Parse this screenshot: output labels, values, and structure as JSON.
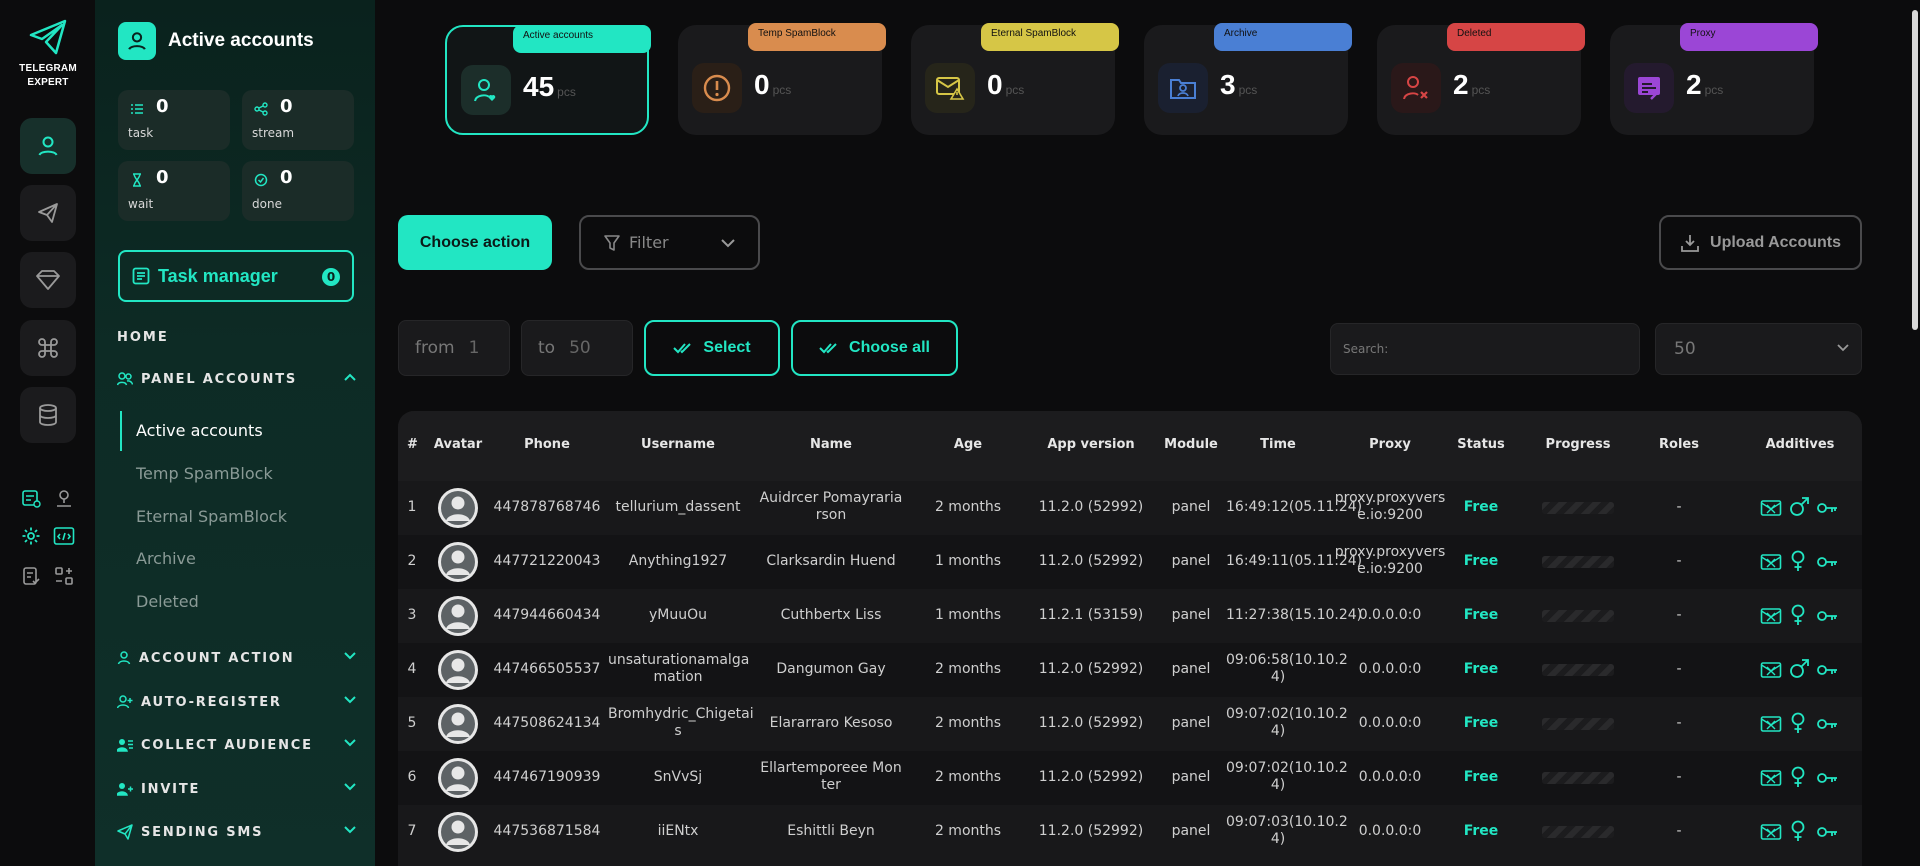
{
  "app": {
    "logo_line1": "TELEGRAM",
    "logo_line2": "EXPERT"
  },
  "sidebar": {
    "title": "Active accounts",
    "stats": [
      {
        "value": "0",
        "label": "task"
      },
      {
        "value": "0",
        "label": "stream"
      },
      {
        "value": "0",
        "label": "wait"
      },
      {
        "value": "0",
        "label": "done"
      }
    ],
    "task_manager": {
      "label": "Task manager",
      "count": "0"
    },
    "home_label": "HOME",
    "panel_accounts": "PANEL ACCOUNTS",
    "sub_items": [
      "Active accounts",
      "Temp SpamBlock",
      "Eternal SpamBlock",
      "Archive",
      "Deleted"
    ],
    "sections": [
      "ACCOUNT ACTION",
      "AUTO-REGISTER",
      "COLLECT AUDIENCE",
      "INVITE",
      "SENDING SMS"
    ]
  },
  "cards": [
    {
      "tag": "Active accounts",
      "value": "45",
      "unit": "pcs",
      "color": "#22e6c3",
      "icon": "user-heart-icon"
    },
    {
      "tag": "Temp SpamBlock",
      "value": "0",
      "unit": "pcs",
      "color": "#d98c4e",
      "icon": "warning-circle-icon"
    },
    {
      "tag": "Eternal SpamBlock",
      "value": "0",
      "unit": "pcs",
      "color": "#d6c646",
      "icon": "mail-warning-icon"
    },
    {
      "tag": "Archive",
      "value": "3",
      "unit": "pcs",
      "color": "#4a7fd4",
      "icon": "archive-user-icon"
    },
    {
      "tag": "Deleted",
      "value": "2",
      "unit": "pcs",
      "color": "#d64545",
      "icon": "user-x-icon"
    },
    {
      "tag": "Proxy",
      "value": "2",
      "unit": "pcs",
      "color": "#9b46d6",
      "icon": "proxy-icon"
    }
  ],
  "toolbar": {
    "choose_action": "Choose action",
    "filter": "Filter",
    "upload": "Upload Accounts",
    "from_label": "from",
    "from_value": "1",
    "to_label": "to",
    "to_value": "50",
    "select": "Select",
    "choose_all": "Choose all",
    "search_placeholder": "Search:",
    "per_page": "50"
  },
  "table": {
    "headers": [
      "#",
      "Avatar",
      "Phone",
      "Username",
      "Name",
      "Age",
      "App version",
      "Module",
      "Time",
      "Proxy",
      "Status",
      "Progress",
      "Roles",
      "Additives"
    ],
    "rows": [
      {
        "num": "1",
        "phone": "447878768746",
        "username": [
          "tellurium_dassent"
        ],
        "name": [
          "Auidrcer Pomayraria",
          "rson"
        ],
        "age": "2 months",
        "app": "11.2.0 (52992)",
        "module": "panel",
        "time": [
          "16:49:12(05.11.24)"
        ],
        "proxy": [
          "proxy.proxyvers",
          "e.io:9200"
        ],
        "status": "Free",
        "roles": "-",
        "gender": "male"
      },
      {
        "num": "2",
        "phone": "447721220043",
        "username": [
          "Anything1927"
        ],
        "name": [
          "Clarksardin Huend"
        ],
        "age": "1 months",
        "app": "11.2.0 (52992)",
        "module": "panel",
        "time": [
          "16:49:11(05.11.24)"
        ],
        "proxy": [
          "proxy.proxyvers",
          "e.io:9200"
        ],
        "status": "Free",
        "roles": "-",
        "gender": "female"
      },
      {
        "num": "3",
        "phone": "447944660434",
        "username": [
          "yMuuOu"
        ],
        "name": [
          "Cuthbertx Liss"
        ],
        "age": "1 months",
        "app": "11.2.1 (53159)",
        "module": "panel",
        "time": [
          "11:27:38(15.10.24)"
        ],
        "proxy": [
          "0.0.0.0:0"
        ],
        "status": "Free",
        "roles": "-",
        "gender": "female"
      },
      {
        "num": "4",
        "phone": "447466505537",
        "username": [
          "unsaturationamalga",
          "mation"
        ],
        "name": [
          "Dangumon Gay"
        ],
        "age": "2 months",
        "app": "11.2.0 (52992)",
        "module": "panel",
        "time": [
          "09:06:58(10.10.2",
          "4)"
        ],
        "proxy": [
          "0.0.0.0:0"
        ],
        "status": "Free",
        "roles": "-",
        "gender": "male"
      },
      {
        "num": "5",
        "phone": "447508624134",
        "username": [
          "Bromhydric_Chigetai",
          "s"
        ],
        "name": [
          "Elararraro Kesoso"
        ],
        "age": "2 months",
        "app": "11.2.0 (52992)",
        "module": "panel",
        "time": [
          "09:07:02(10.10.2",
          "4)"
        ],
        "proxy": [
          "0.0.0.0:0"
        ],
        "status": "Free",
        "roles": "-",
        "gender": "female"
      },
      {
        "num": "6",
        "phone": "447467190939",
        "username": [
          "SnVvSj"
        ],
        "name": [
          "Ellartemporeee Mon",
          "ter"
        ],
        "age": "2 months",
        "app": "11.2.0 (52992)",
        "module": "panel",
        "time": [
          "09:07:02(10.10.2",
          "4)"
        ],
        "proxy": [
          "0.0.0.0:0"
        ],
        "status": "Free",
        "roles": "-",
        "gender": "female"
      },
      {
        "num": "7",
        "phone": "447536871584",
        "username": [
          "iiENtx"
        ],
        "name": [
          "Eshittli Beyn"
        ],
        "age": "2 months",
        "app": "11.2.0 (52992)",
        "module": "panel",
        "time": [
          "09:07:03(10.10.2",
          "4)"
        ],
        "proxy": [
          "0.0.0.0:0"
        ],
        "status": "Free",
        "roles": "-",
        "gender": "female"
      }
    ]
  }
}
